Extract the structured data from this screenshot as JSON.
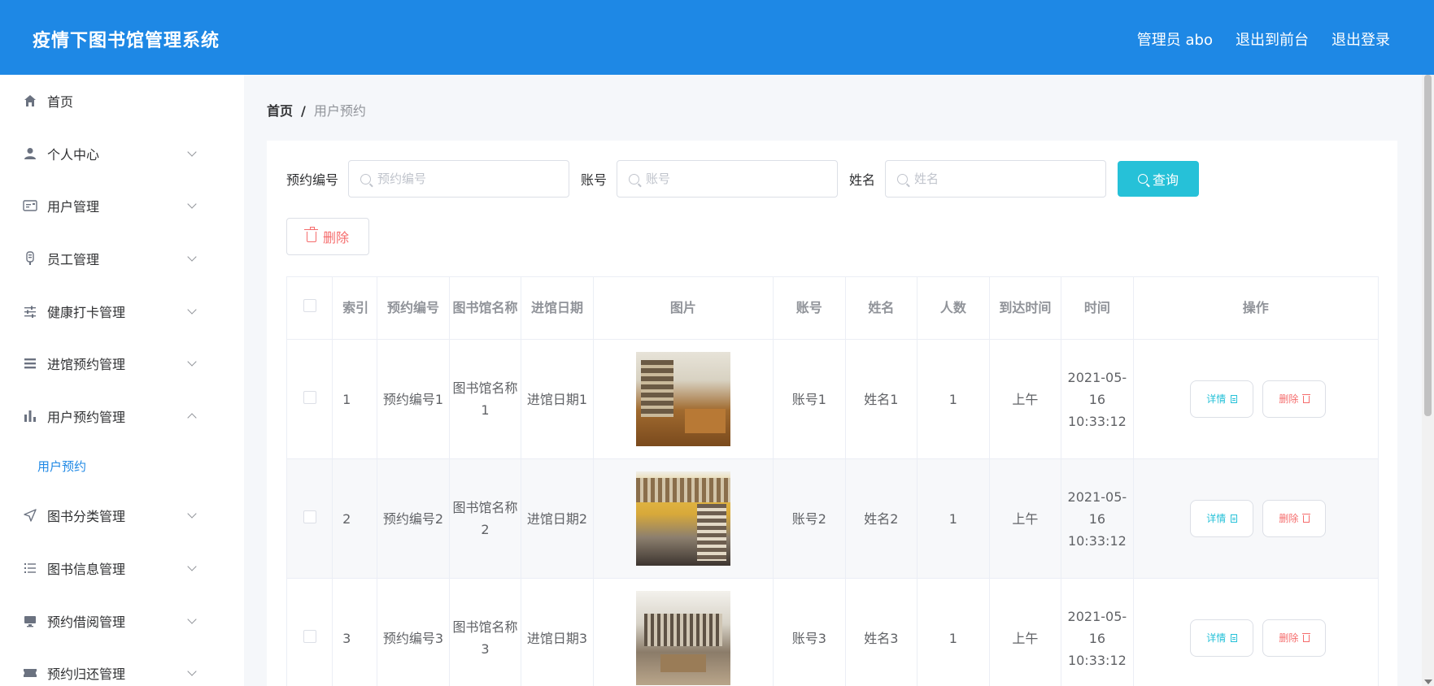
{
  "header": {
    "title": "疫情下图书馆管理系统",
    "admin": "管理员 abo",
    "to_front": "退出到前台",
    "logout": "退出登录"
  },
  "sidebar": {
    "items": [
      {
        "label": "首页",
        "icon": "home-icon"
      },
      {
        "label": "个人中心",
        "icon": "user-icon"
      },
      {
        "label": "用户管理",
        "icon": "id-card-icon"
      },
      {
        "label": "员工管理",
        "icon": "badge-icon"
      },
      {
        "label": "健康打卡管理",
        "icon": "sliders-icon"
      },
      {
        "label": "进馆预约管理",
        "icon": "list-icon"
      },
      {
        "label": "用户预约管理",
        "icon": "bar-chart-icon"
      },
      {
        "label": "图书分类管理",
        "icon": "send-icon"
      },
      {
        "label": "图书信息管理",
        "icon": "list-ordered-icon"
      },
      {
        "label": "预约借阅管理",
        "icon": "monitor-icon"
      },
      {
        "label": "预约归还管理",
        "icon": "ticket-icon"
      }
    ],
    "submenu": {
      "label": "用户预约"
    }
  },
  "breadcrumb": {
    "home": "首页",
    "separator": "/",
    "current": "用户预约"
  },
  "search": {
    "label1": "预约编号",
    "placeholder1": "预约编号",
    "label2": "账号",
    "placeholder2": "账号",
    "label3": "姓名",
    "placeholder3": "姓名",
    "query_label": "查询"
  },
  "toolbar": {
    "delete_label": "删除"
  },
  "table": {
    "columns": [
      "索引",
      "预约编号",
      "图书馆名称",
      "进馆日期",
      "图片",
      "账号",
      "姓名",
      "人数",
      "到达时间",
      "时间",
      "操作"
    ],
    "detail_label": "详情",
    "delete_label": "删除",
    "rows": [
      {
        "index": "1",
        "code": "预约编号1",
        "library": "图书馆名称1",
        "date": "进馆日期1",
        "account": "账号1",
        "name": "姓名1",
        "count": "1",
        "arrive": "上午",
        "time": "2021-05-16 10:33:12"
      },
      {
        "index": "2",
        "code": "预约编号2",
        "library": "图书馆名称2",
        "date": "进馆日期2",
        "account": "账号2",
        "name": "姓名2",
        "count": "1",
        "arrive": "上午",
        "time": "2021-05-16 10:33:12"
      },
      {
        "index": "3",
        "code": "预约编号3",
        "library": "图书馆名称3",
        "date": "进馆日期3",
        "account": "账号3",
        "name": "姓名3",
        "count": "1",
        "arrive": "上午",
        "time": "2021-05-16 10:33:12"
      }
    ]
  },
  "colors": {
    "header": "#1e88e5",
    "primary": "#26c1d8",
    "danger": "#f56c6c"
  }
}
